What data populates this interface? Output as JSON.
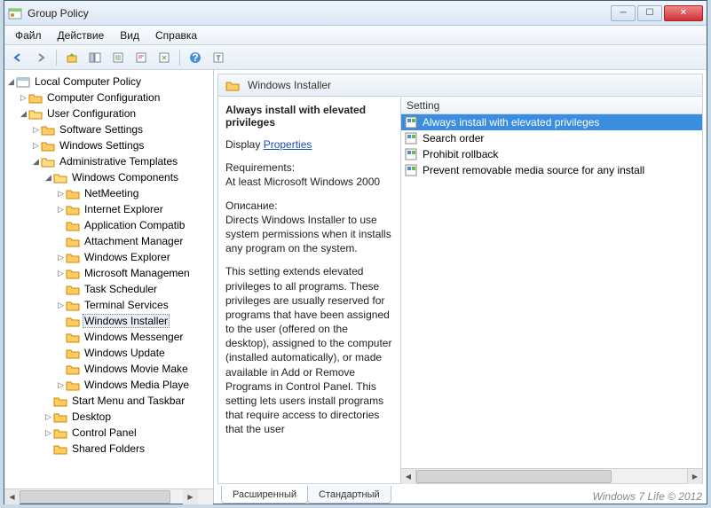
{
  "titlebar": {
    "title": "Group Policy"
  },
  "menu": {
    "file": "Файл",
    "action": "Действие",
    "view": "Вид",
    "help": "Справка"
  },
  "tree": {
    "root": "Local Computer Policy",
    "comp": "Computer Configuration",
    "user": "User Configuration",
    "soft": "Software Settings",
    "wins": "Windows Settings",
    "admin": "Administrative Templates",
    "wcomp": "Windows Components",
    "nm": "NetMeeting",
    "ie": "Internet Explorer",
    "ac": "Application Compatib",
    "am": "Attachment Manager",
    "we": "Windows Explorer",
    "mm": "Microsoft Managemen",
    "ts": "Task Scheduler",
    "term": "Terminal Services",
    "wi": "Windows Installer",
    "wmsg": "Windows Messenger",
    "wu": "Windows Update",
    "wmm": "Windows Movie Make",
    "wmp": "Windows Media Playe",
    "start": "Start Menu and Taskbar",
    "desk": "Desktop",
    "cp": "Control Panel",
    "sf": "Shared Folders"
  },
  "header": {
    "label": "Windows Installer"
  },
  "desc": {
    "title": "Always install with elevated privileges",
    "display": "Display",
    "properties": "Properties",
    "req_label": "Requirements:",
    "req_text": "At least Microsoft Windows 2000",
    "d_label": "Описание:",
    "d1": "Directs Windows Installer to use system permissions when it installs any program on the system.",
    "d2": "This setting extends elevated privileges to all programs. These privileges are usually reserved for programs that have been assigned to the user (offered on the desktop), assigned to the computer (installed automatically), or made available in Add or Remove Programs in Control Panel. This setting lets users install programs that require access to directories that the user"
  },
  "list": {
    "col": "Setting",
    "items": [
      "Always install with elevated privileges",
      "Search order",
      "Prohibit rollback",
      "Prevent removable media source for any install"
    ]
  },
  "tabs": {
    "ext": "Расширенный",
    "std": "Стандартный"
  },
  "watermark": "Windows 7 Life © 2012"
}
